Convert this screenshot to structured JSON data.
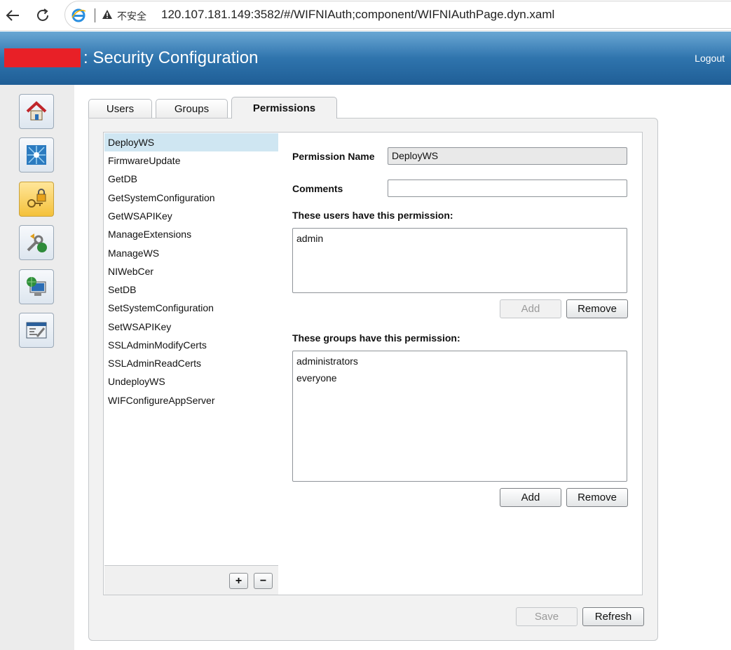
{
  "browser": {
    "back_icon": "back-arrow-icon",
    "refresh_icon": "refresh-icon",
    "site_icon": "ie-logo-icon",
    "warning_icon": "warning-triangle-icon",
    "insecure_label": "不安全",
    "url": "120.107.181.149:3582/#/WIFNIAuth;component/WIFNIAuthPage.dyn.xaml"
  },
  "header": {
    "title": ": Security Configuration",
    "logout_label": "Logout",
    "brand_color": "#2f74ad",
    "redaction_color": "#e82027"
  },
  "sidebar": {
    "items": [
      {
        "icon": "home-icon"
      },
      {
        "icon": "network-icon"
      },
      {
        "icon": "security-lock-icon",
        "active": true
      },
      {
        "icon": "tools-update-icon"
      },
      {
        "icon": "computer-globe-icon"
      },
      {
        "icon": "console-window-icon"
      }
    ]
  },
  "tabs": [
    {
      "label": "Users"
    },
    {
      "label": "Groups"
    },
    {
      "label": "Permissions",
      "active": true
    }
  ],
  "permissions": {
    "selected": "DeployWS",
    "items": [
      "DeployWS",
      "FirmwareUpdate",
      "GetDB",
      "GetSystemConfiguration",
      "GetWSAPIKey",
      "ManageExtensions",
      "ManageWS",
      "NIWebCer",
      "SetDB",
      "SetSystemConfiguration",
      "SetWSAPIKey",
      "SSLAdminModifyCerts",
      "SSLAdminReadCerts",
      "UndeployWS",
      "WIFConfigureAppServer"
    ],
    "add_symbol": "+",
    "remove_symbol": "−"
  },
  "detail": {
    "permission_name_label": "Permission Name",
    "permission_name_value": "DeployWS",
    "comments_label": "Comments",
    "comments_value": "",
    "users_heading": "These users have this permission:",
    "users": [
      "admin"
    ],
    "groups_heading": "These groups have this permission:",
    "groups": [
      "administrators",
      "everyone"
    ],
    "add_label": "Add",
    "remove_label": "Remove"
  },
  "footer": {
    "save_label": "Save",
    "refresh_label": "Refresh"
  }
}
